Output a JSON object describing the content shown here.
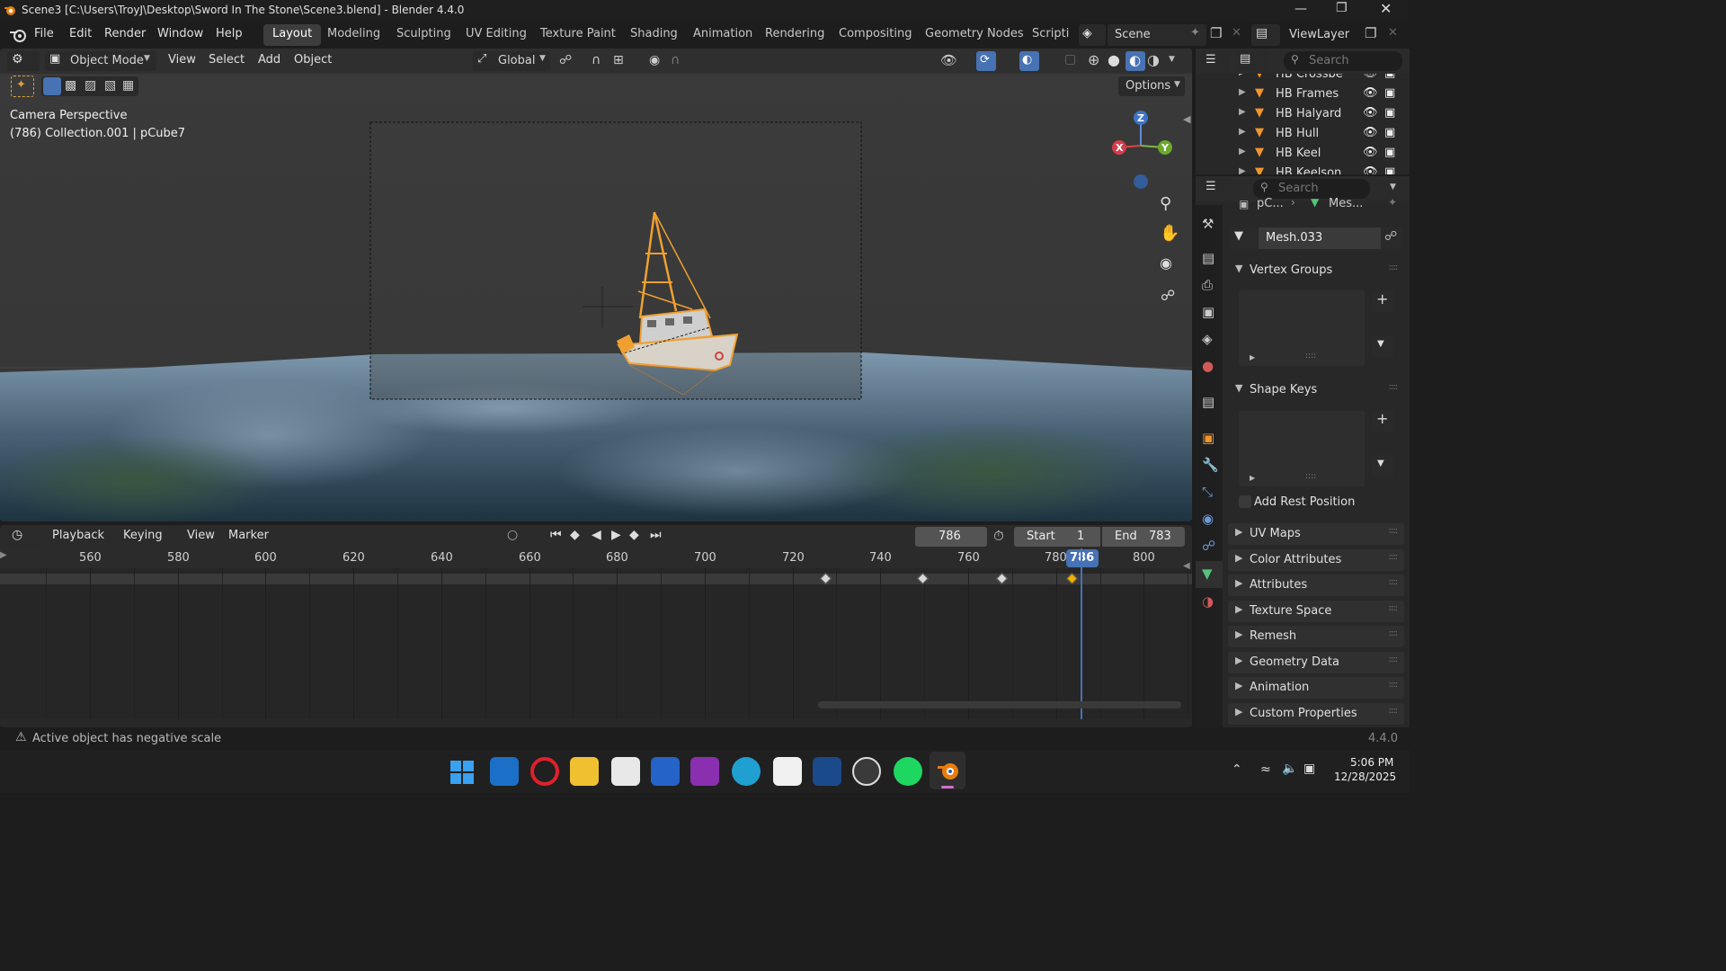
{
  "window": {
    "title": "Scene3 [C:\\Users\\TroyJ\\Desktop\\Sword In The Stone\\Scene3.blend] - Blender 4.4.0"
  },
  "menu": [
    "File",
    "Edit",
    "Render",
    "Window",
    "Help"
  ],
  "workspaces": [
    "Layout",
    "Modeling",
    "Sculpting",
    "UV Editing",
    "Texture Paint",
    "Shading",
    "Animation",
    "Rendering",
    "Compositing",
    "Geometry Nodes",
    "Scripti"
  ],
  "scene": {
    "name": "Scene",
    "view_layer": "ViewLayer"
  },
  "viewport": {
    "mode": "Object Mode",
    "menus": [
      "View",
      "Select",
      "Add",
      "Object"
    ],
    "orientation": "Global",
    "options": "Options",
    "overlay_line1": "Camera Perspective",
    "overlay_line2": "(786) Collection.001 | pCube7",
    "gizmo": {
      "x": "X",
      "y": "Y",
      "z": "Z"
    }
  },
  "timeline": {
    "menus": [
      "Playback",
      "Keying",
      "View",
      "Marker"
    ],
    "current_frame": "786",
    "start_label": "Start",
    "start": "1",
    "end_label": "End",
    "end": "783",
    "ruler": [
      "560",
      "580",
      "600",
      "620",
      "640",
      "660",
      "680",
      "700",
      "720",
      "740",
      "760",
      "780",
      "800"
    ],
    "playhead_label": "786",
    "keyframes": [
      730,
      752,
      770,
      786
    ]
  },
  "outliner": {
    "search_placeholder": "Search",
    "items": [
      "HB Crossbe",
      "HB Frames",
      "HB Halyard",
      "HB Hull",
      "HB Keel",
      "HB Keelson"
    ]
  },
  "properties": {
    "search_placeholder": "Search",
    "breadcrumb": [
      "pC...",
      "Mes..."
    ],
    "mesh_name": "Mesh.033",
    "panels_open": [
      "Vertex Groups",
      "Shape Keys"
    ],
    "add_rest_position": "Add Rest Position",
    "panels_closed": [
      "UV Maps",
      "Color Attributes",
      "Attributes",
      "Texture Space",
      "Remesh",
      "Geometry Data",
      "Animation",
      "Custom Properties"
    ]
  },
  "status": {
    "warning": "Active object has negative scale",
    "version": "4.4.0"
  },
  "taskbar": {
    "time": "5:06 PM",
    "date": "12/28/2025"
  },
  "colors": {
    "accent": "#4772b3",
    "selection": "#f0a030",
    "keyframe_selected": "#f0b000"
  }
}
